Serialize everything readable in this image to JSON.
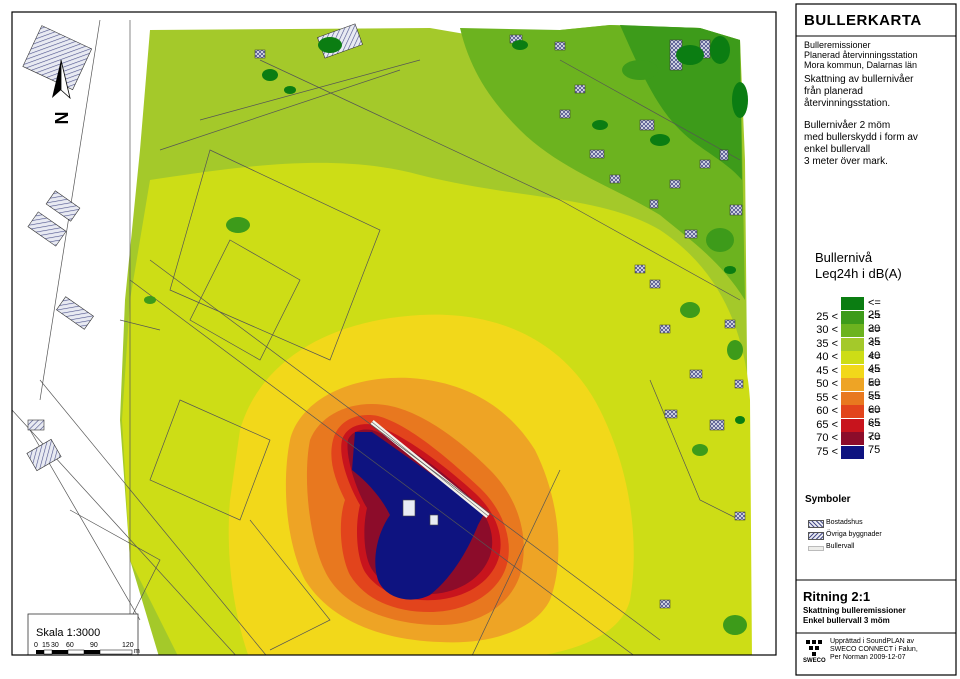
{
  "colors": {
    "le25": "#0b7d12",
    "b25_30": "#3d9b1a",
    "b30_35": "#6cb31f",
    "b35_40": "#a4c92a",
    "b40_45": "#cddd16",
    "b45_50": "#f2d81a",
    "b50_55": "#eea425",
    "b55_60": "#e8781f",
    "b60_65": "#e2441c",
    "b65_70": "#c8141d",
    "b70_75": "#8c0c2a",
    "gt75": "#0e1380"
  },
  "title": "BULLERKARTA",
  "subtitle_lines": [
    "Bulleremissioner",
    "Planerad återvinningsstation",
    "Mora kommun, Dalarnas län"
  ],
  "desc1_lines": [
    "Skattning av bullernivåer",
    "från planerad",
    "återvinningsstation."
  ],
  "desc2_lines": [
    "Bullernivåer 2 möm",
    "med bullerskydd i form av",
    "enkel bullervall",
    "3 meter över mark."
  ],
  "legend": {
    "title_lines": [
      "Bullernivå",
      "Leq24h i dB(A)"
    ],
    "rows": [
      {
        "lo": "",
        "hi": "<= 25",
        "color_key": "le25"
      },
      {
        "lo": "25 <",
        "hi": "<= 30",
        "color_key": "b25_30"
      },
      {
        "lo": "30 <",
        "hi": "<= 35",
        "color_key": "b30_35"
      },
      {
        "lo": "35 <",
        "hi": "<= 40",
        "color_key": "b35_40"
      },
      {
        "lo": "40 <",
        "hi": "<= 45",
        "color_key": "b40_45"
      },
      {
        "lo": "45 <",
        "hi": "<= 50",
        "color_key": "b45_50"
      },
      {
        "lo": "50 <",
        "hi": "<= 55",
        "color_key": "b50_55"
      },
      {
        "lo": "55 <",
        "hi": "<= 60",
        "color_key": "b55_60"
      },
      {
        "lo": "60 <",
        "hi": "<= 65",
        "color_key": "b60_65"
      },
      {
        "lo": "65 <",
        "hi": "<= 70",
        "color_key": "b65_70"
      },
      {
        "lo": "70 <",
        "hi": "<= 75",
        "color_key": "b70_75"
      },
      {
        "lo": "75 <",
        "hi": "",
        "color_key": "gt75"
      }
    ]
  },
  "symbols": {
    "title": "Symboler",
    "items": [
      {
        "label": "Bostadshus",
        "icon": "hatch-cross-icon"
      },
      {
        "label": "Övriga byggnader",
        "icon": "hatch-diagonal-icon"
      },
      {
        "label": "Bullervall",
        "icon": "wall-icon"
      }
    ]
  },
  "drawing": {
    "title": "Ritning 2:1",
    "line1": "Skattning bulleremissioner",
    "line2": "Enkel bullervall 3 möm"
  },
  "credit_lines": [
    "Upprättad i SoundPLAN av",
    "SWECO CONNECT i Falun,",
    "Per Norman 2009-12-07"
  ],
  "logo_text": "SWECO",
  "scale": {
    "label": "Skala 1:3000",
    "ticks": [
      "0",
      "15",
      "30",
      "60",
      "90",
      "120"
    ],
    "unit": "m"
  },
  "north_label": "N"
}
